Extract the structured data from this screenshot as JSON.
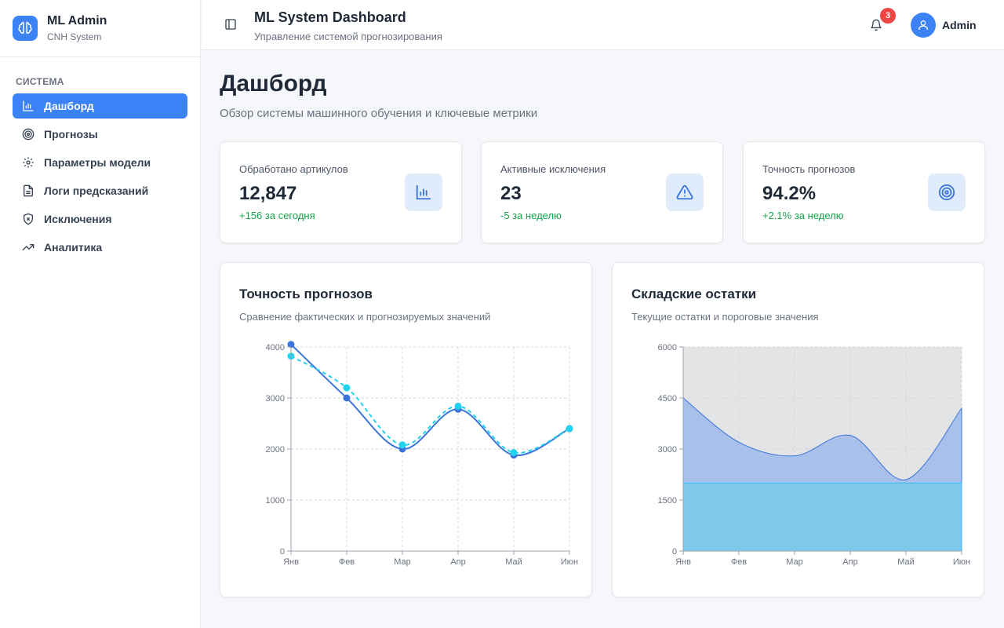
{
  "brand": {
    "title": "ML Admin",
    "subtitle": "CNH System",
    "logo_icon": "brain-icon"
  },
  "sidebar": {
    "heading": "Система",
    "items": [
      {
        "label": "Дашборд",
        "icon": "bar-chart-icon",
        "active": true
      },
      {
        "label": "Прогнозы",
        "icon": "target-icon",
        "active": false
      },
      {
        "label": "Параметры модели",
        "icon": "gear-icon",
        "active": false
      },
      {
        "label": "Логи предсказаний",
        "icon": "file-text-icon",
        "active": false
      },
      {
        "label": "Исключения",
        "icon": "shield-x-icon",
        "active": false
      },
      {
        "label": "Аналитика",
        "icon": "trending-up-icon",
        "active": false
      }
    ]
  },
  "header": {
    "title": "ML System Dashboard",
    "subtitle": "Управление системой прогнозирования",
    "notifications_count": "3",
    "user_name": "Admin"
  },
  "page": {
    "title": "Дашборд",
    "subtitle": "Обзор системы машинного обучения и ключевые метрики"
  },
  "stats": [
    {
      "label": "Обработано артикулов",
      "value": "12,847",
      "delta": "+156 за сегодня",
      "icon": "bar-chart-icon"
    },
    {
      "label": "Активные исключения",
      "value": "23",
      "delta": "-5 за неделю",
      "icon": "warning-triangle-icon"
    },
    {
      "label": "Точность прогнозов",
      "value": "94.2%",
      "delta": "+2.1% за неделю",
      "icon": "target-icon"
    }
  ],
  "colors": {
    "accent": "#3b82f6",
    "series_actual": "#3b74db",
    "series_forecast": "#22d3ee",
    "stock_fill": "#a9c0eb",
    "threshold_fill": "#7ec8ec",
    "delta_positive": "#16a34a",
    "badge": "#ef4444"
  },
  "chart_data": [
    {
      "type": "line",
      "title": "Точность прогнозов",
      "subtitle": "Сравнение фактических и прогнозируемых значений",
      "categories": [
        "Янв",
        "Фев",
        "Мар",
        "Апр",
        "Май",
        "Июн"
      ],
      "series": [
        {
          "values": [
            4050,
            3000,
            2000,
            2780,
            1880,
            2400
          ],
          "style": "solid"
        },
        {
          "values": [
            3820,
            3200,
            2080,
            2840,
            1930,
            2400
          ],
          "style": "dashed"
        }
      ],
      "ylim": [
        0,
        4000
      ],
      "yticks": [
        0,
        1000,
        2000,
        3000,
        4000
      ],
      "grid": true
    },
    {
      "type": "area",
      "title": "Складские остатки",
      "subtitle": "Текущие остатки и пороговые значения",
      "categories": [
        "Янв",
        "Фев",
        "Мар",
        "Апр",
        "Май",
        "Июн"
      ],
      "series": [
        {
          "values": [
            4500,
            3200,
            2800,
            3400,
            2100,
            4200
          ]
        },
        {
          "values": [
            2000,
            2000,
            2000,
            2000,
            2000,
            2000
          ]
        }
      ],
      "ylim": [
        0,
        6000
      ],
      "yticks": [
        0,
        1500,
        3000,
        4500,
        6000
      ],
      "grid": true
    }
  ]
}
